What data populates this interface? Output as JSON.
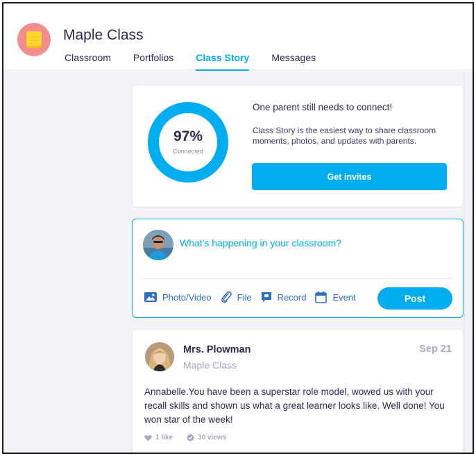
{
  "header": {
    "class_name": "Maple Class",
    "tabs": [
      {
        "label": "Classroom",
        "active": false
      },
      {
        "label": "Portfolios",
        "active": false
      },
      {
        "label": "Class Story",
        "active": true
      },
      {
        "label": "Messages",
        "active": false
      }
    ]
  },
  "invite_card": {
    "percent": "97%",
    "percent_value": 97,
    "percent_label": "Connected",
    "heading": "One parent still needs to connect!",
    "text": "Class Story is the easiest way to share classroom moments, photos, and updates with parents.",
    "button_label": "Get invites"
  },
  "composer": {
    "prompt": "What's happening in your classroom?",
    "actions": {
      "photo_video": "Photo/Video",
      "file": "File",
      "record": "Record",
      "event": "Event"
    },
    "post_label": "Post"
  },
  "post": {
    "author": "Mrs. Plowman",
    "class_name": "Maple Class",
    "date": "Sep 21",
    "body": "Annabelle.You have been a superstar role model, wowed us with your recall skills and shown us what a great learner looks like. Well done! You won star of the week!",
    "likes": "1 like",
    "views": "30 views"
  },
  "colors": {
    "accent": "#00aef0",
    "text": "#2c2a50",
    "muted": "#a3a9c2",
    "link": "#2f6ec6",
    "avatar_bg": "#f48c8c"
  }
}
